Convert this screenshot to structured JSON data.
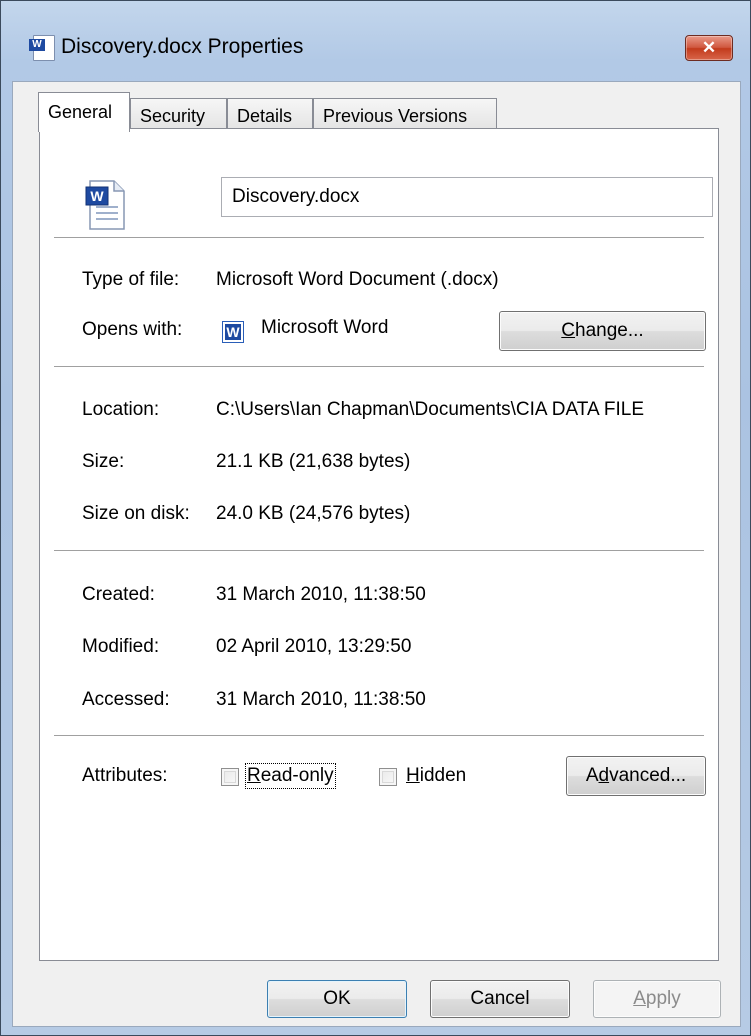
{
  "window": {
    "title": "Discovery.docx Properties",
    "close_icon": "close-icon",
    "close_glyph": "✕",
    "accent_color": "#c23a1c"
  },
  "tabs": [
    {
      "label": "General",
      "active": true
    },
    {
      "label": "Security",
      "active": false
    },
    {
      "label": "Details",
      "active": false
    },
    {
      "label": "Previous Versions",
      "active": false
    }
  ],
  "general": {
    "file_icon": "word-document-icon",
    "file_name": "Discovery.docx",
    "type_label": "Type of file:",
    "type_value": "Microsoft Word Document (.docx)",
    "opens_label": "Opens with:",
    "opens_app_icon": "word-app-icon",
    "opens_value": "Microsoft Word",
    "change_button": {
      "prefix": "",
      "accel": "C",
      "suffix": "hange..."
    },
    "location_label": "Location:",
    "location_value": "C:\\Users\\Ian Chapman\\Documents\\CIA DATA FILE",
    "size_label": "Size:",
    "size_value": "21.1 KB (21,638 bytes)",
    "size_on_disk_label": "Size on disk:",
    "size_on_disk_value": "24.0 KB (24,576 bytes)",
    "created_label": "Created:",
    "created_value": "31 March 2010, 11:38:50",
    "modified_label": "Modified:",
    "modified_value": "02 April 2010, 13:29:50",
    "accessed_label": "Accessed:",
    "accessed_value": "31 March 2010, 11:38:50",
    "attributes_label": "Attributes:",
    "readonly": {
      "accel": "R",
      "rest": "ead-only",
      "checked": false
    },
    "hidden": {
      "accel": "H",
      "rest": "idden",
      "checked": false
    },
    "advanced_button": {
      "prefix": "A",
      "accel": "d",
      "suffix": "vanced..."
    }
  },
  "footer": {
    "ok_label": "OK",
    "cancel_label": "Cancel",
    "apply": {
      "accel": "A",
      "rest": "pply",
      "enabled": false
    }
  }
}
